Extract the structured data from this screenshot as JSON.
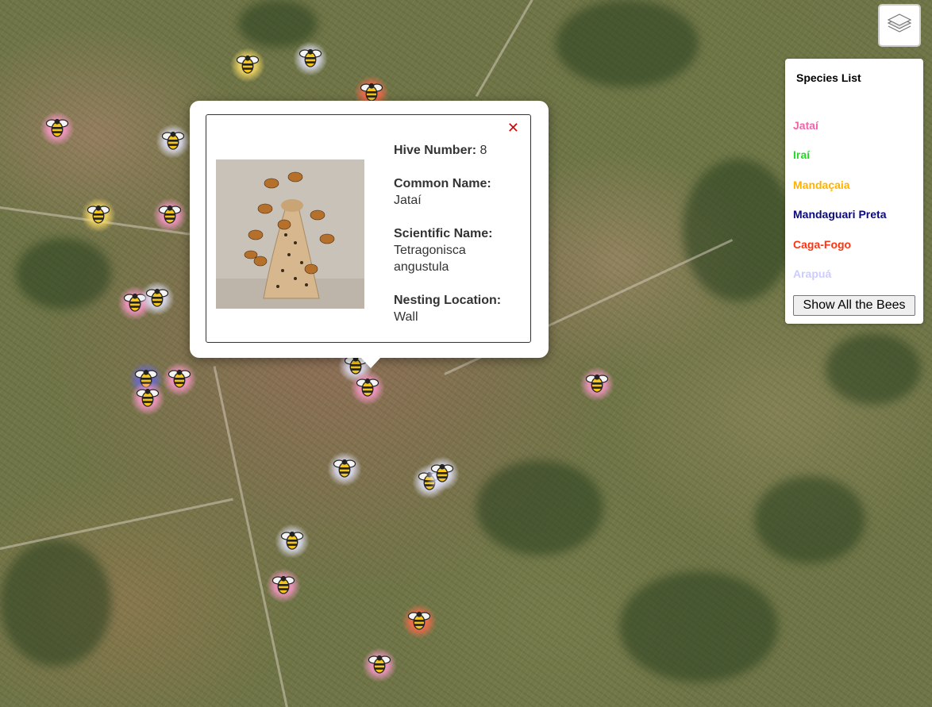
{
  "map": {
    "type": "satellite"
  },
  "layers_control": {
    "icon": "layers-icon"
  },
  "legend": {
    "title": "Species List",
    "species": [
      {
        "name": "Jataí",
        "color": "#ee66aa"
      },
      {
        "name": "Iraí",
        "color": "#22dd22"
      },
      {
        "name": "Mandaçaia",
        "color": "#ffb300"
      },
      {
        "name": "Mandaguari Preta",
        "color": "#0a0a7a"
      },
      {
        "name": "Caga-Fogo",
        "color": "#ff3311"
      },
      {
        "name": "Arapuá",
        "color": "#ccccff"
      }
    ],
    "show_all_label": "Show All the Bees"
  },
  "popup": {
    "close_symbol": "✕",
    "hive_number_label": "Hive Number:",
    "hive_number": "8",
    "common_name_label": "Common Name:",
    "common_name": "Jataí",
    "scientific_name_label": "Scientific Name:",
    "scientific_name": "Tetragonisca angustula",
    "nesting_location_label": "Nesting Location:",
    "nesting_location": "Wall"
  },
  "markers": [
    {
      "species": "Mandaçaia",
      "glow": "#ffe066"
    },
    {
      "species": "Arapuá",
      "glow": "#e6e6ff"
    },
    {
      "species": "Caga-Fogo",
      "glow": "#ff6a4a"
    },
    {
      "species": "Jataí",
      "glow": "#ff99cc"
    },
    {
      "species": "Arapuá",
      "glow": "#e6e6ff"
    },
    {
      "species": "Mandaçaia",
      "glow": "#ffe066"
    },
    {
      "species": "Jataí",
      "glow": "#ff99cc"
    },
    {
      "species": "Jataí",
      "glow": "#ff99cc"
    },
    {
      "species": "Arapuá",
      "glow": "#e6e6ff"
    },
    {
      "species": "Jataí",
      "glow": "#ff99cc"
    },
    {
      "species": "Mandaguari Preta",
      "glow": "#6a6ad0"
    },
    {
      "species": "Jataí",
      "glow": "#ff99cc"
    },
    {
      "species": "Arapuá",
      "glow": "#e6e6ff"
    },
    {
      "species": "Jataí",
      "glow": "#ff99cc"
    },
    {
      "species": "Jataí",
      "glow": "#ff99cc"
    },
    {
      "species": "Arapuá",
      "glow": "#e6e6ff"
    },
    {
      "species": "Arapuá",
      "glow": "#e6e6ff"
    },
    {
      "species": "Arapuá",
      "glow": "#e6e6ff"
    },
    {
      "species": "Arapuá",
      "glow": "#e6e6ff"
    },
    {
      "species": "Jataí",
      "glow": "#ff99cc"
    },
    {
      "species": "Caga-Fogo",
      "glow": "#ff6a4a"
    },
    {
      "species": "Jataí",
      "glow": "#ff99cc"
    }
  ]
}
